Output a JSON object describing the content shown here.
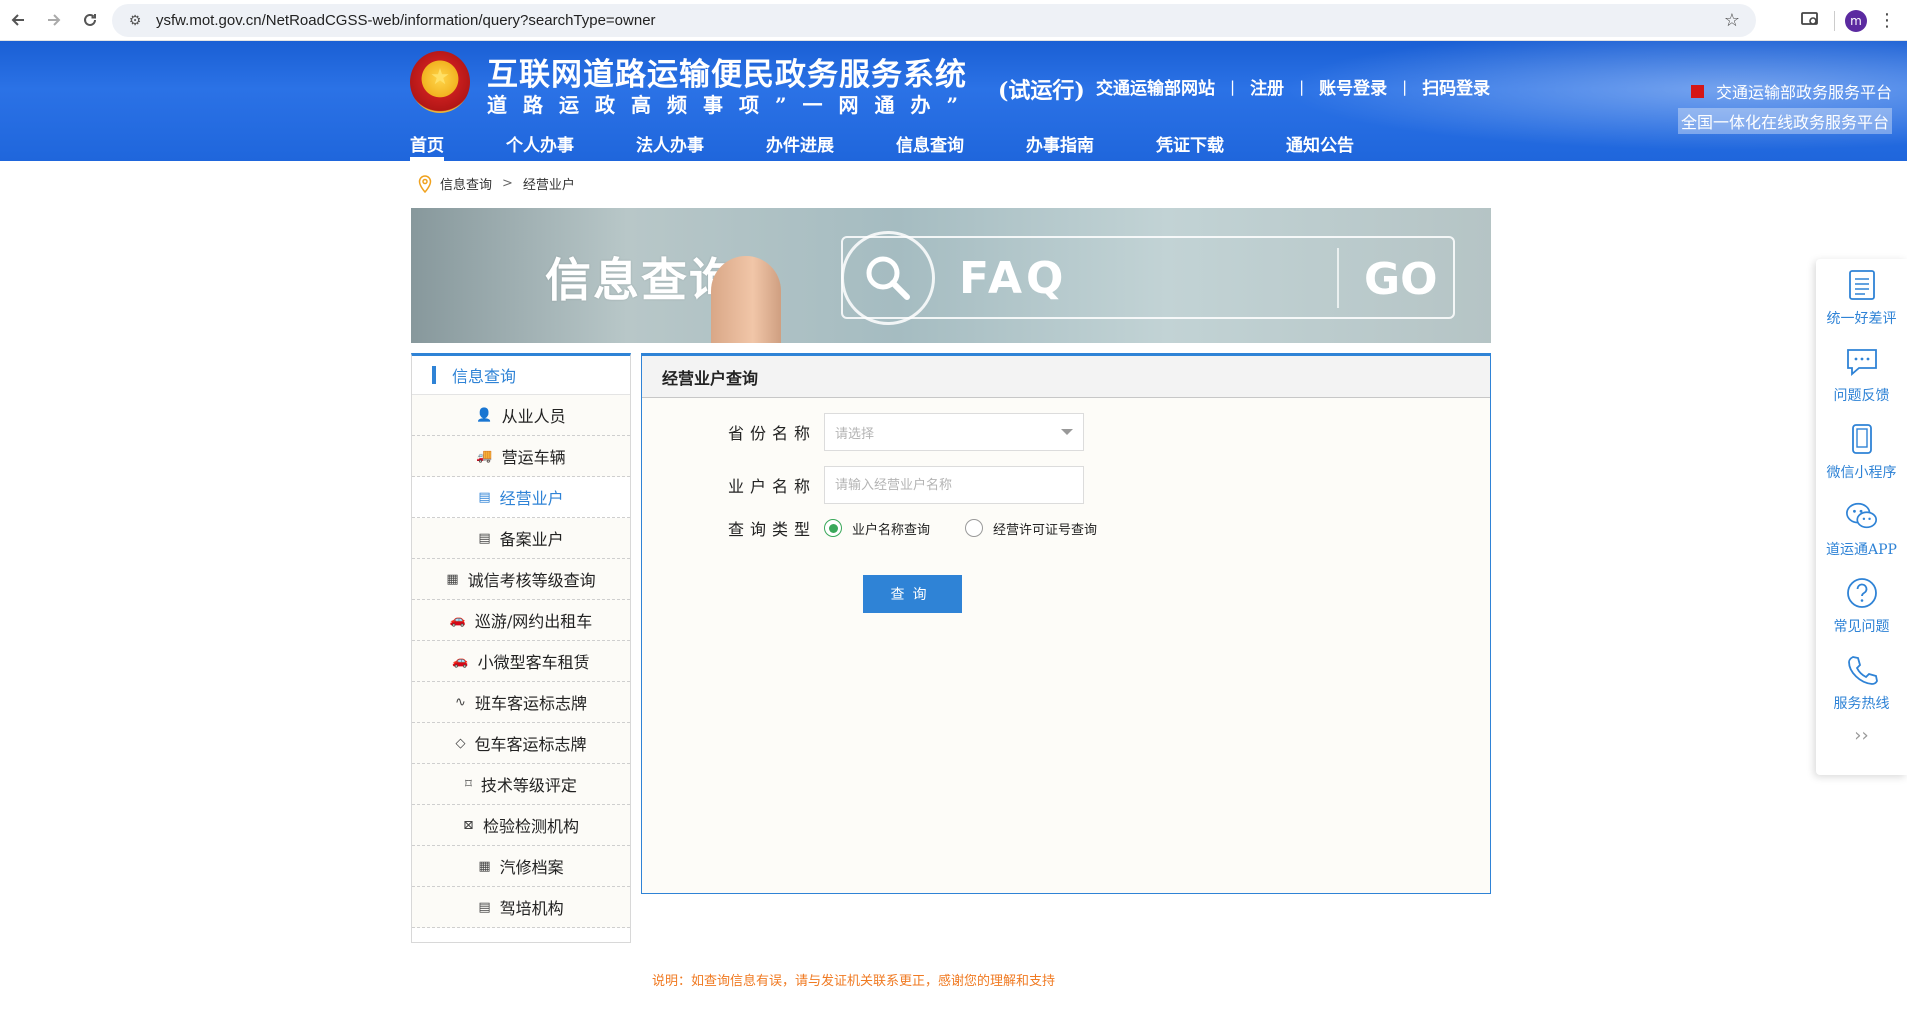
{
  "browser": {
    "url": "ysfw.mot.gov.cn/NetRoadCGSS-web/information/query?searchType=owner",
    "profile_initial": "m"
  },
  "header": {
    "title": "互联网道路运输便民政务服务系统",
    "subtitle": "道路运政高频事项”一网通办”",
    "trial": "(试运行)",
    "emblem_glyph": "★",
    "top_links": [
      "交通运输部网站",
      "注册",
      "账号登录",
      "扫码登录"
    ],
    "gov_link_1": "交通运输部政务服务平台",
    "gov_link_2": "全国一体化在线政务服务平台",
    "nav": [
      "首页",
      "个人办事",
      "法人办事",
      "办件进展",
      "信息查询",
      "办事指南",
      "凭证下载",
      "通知公告"
    ]
  },
  "breadcrumb": {
    "items": [
      "信息查询",
      "经营业户"
    ],
    "separator": ">"
  },
  "banner": {
    "title": "信息查询",
    "faq": "FAQ",
    "go": "GO"
  },
  "sidebar": {
    "title": "信息查询",
    "items": [
      {
        "label": "从业人员",
        "icon": "person-card-icon"
      },
      {
        "label": "营运车辆",
        "icon": "truck-icon"
      },
      {
        "label": "经营业户",
        "icon": "building-icon"
      },
      {
        "label": "备案业户",
        "icon": "building-icon"
      },
      {
        "label": "诚信考核等级查询",
        "icon": "document-icon"
      },
      {
        "label": "巡游/网约出租车",
        "icon": "car-icon"
      },
      {
        "label": "小微型客车租赁",
        "icon": "car-icon"
      },
      {
        "label": "班车客运标志牌",
        "icon": "route-icon"
      },
      {
        "label": "包车客运标志牌",
        "icon": "tag-icon"
      },
      {
        "label": "技术等级评定",
        "icon": "bookmark-icon"
      },
      {
        "label": "检验检测机构",
        "icon": "monitor-icon"
      },
      {
        "label": "汽修档案",
        "icon": "document-icon"
      },
      {
        "label": "驾培机构",
        "icon": "building-icon"
      }
    ],
    "active_index": 2
  },
  "panel": {
    "title": "经营业户查询",
    "province_label": "省份名称",
    "province_placeholder": "请选择",
    "owner_label": "业户名称",
    "owner_placeholder": "请输入经营业户名称",
    "type_label": "查询类型",
    "radio_options": [
      "业户名称查询",
      "经营许可证号查询"
    ],
    "radio_selected": 0,
    "query_button": "查询"
  },
  "note": "说明：如查询信息有误，请与发证机关联系更正，感谢您的理解和支持",
  "float_bar": {
    "items": [
      {
        "label": "统一好差评",
        "icon": "review-list-icon"
      },
      {
        "label": "问题反馈",
        "icon": "chat-bubble-icon"
      },
      {
        "label": "微信小程序",
        "icon": "phone-icon"
      },
      {
        "label": "道运通APP",
        "icon": "wechat-icon"
      },
      {
        "label": "常见问题",
        "icon": "question-icon"
      },
      {
        "label": "服务热线",
        "icon": "telephone-icon"
      }
    ],
    "collapse": "››"
  },
  "colors": {
    "brand_blue": "#2f83d6",
    "header_blue": "#1f66dc",
    "note_orange": "#f07a22",
    "radio_green": "#3aa85a"
  }
}
